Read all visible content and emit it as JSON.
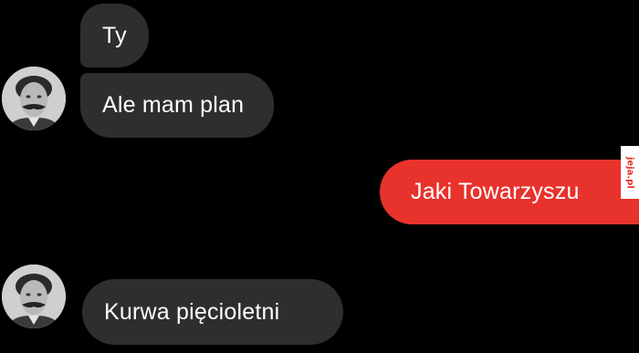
{
  "conversation": {
    "messages": [
      {
        "side": "incoming",
        "text": "Ty"
      },
      {
        "side": "incoming",
        "text": "Ale mam plan"
      },
      {
        "side": "outgoing",
        "text": "Jaki Towarzyszu"
      },
      {
        "side": "incoming",
        "text": "Kurwa pięcioletni"
      }
    ]
  },
  "watermark": {
    "text": "jeja.pl"
  },
  "colors": {
    "background": "#000000",
    "incoming_bubble": "#2e2e30",
    "outgoing_bubble": "#e8322c",
    "text": "#ffffff"
  }
}
